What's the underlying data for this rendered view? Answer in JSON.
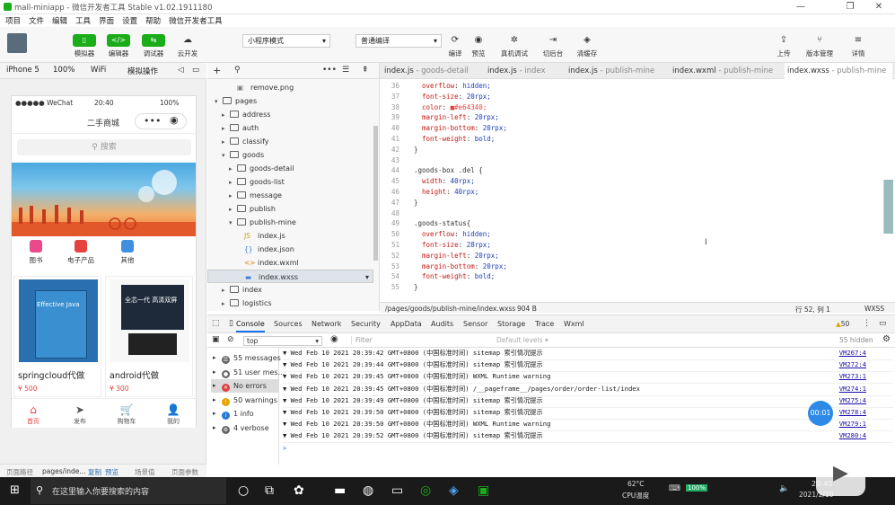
{
  "window": {
    "title": "mall-miniapp - 微信开发者工具 Stable v1.02.1911180",
    "controls": [
      "—",
      "❐",
      "✕"
    ]
  },
  "menu": [
    "项目",
    "文件",
    "编辑",
    "工具",
    "界面",
    "设置",
    "帮助",
    "微信开发者工具"
  ],
  "toolbar": {
    "left": [
      {
        "label": "模拟器",
        "icon": "phone-icon"
      },
      {
        "label": "编辑器",
        "icon": "code-icon"
      },
      {
        "label": "调试器",
        "icon": "debug-icon"
      },
      {
        "label": "云开发",
        "icon": "cloud-icon"
      }
    ],
    "mode_select": "小程序模式",
    "compile_select": "普通编译",
    "middle": [
      {
        "label": "编译",
        "icon": "refresh-icon"
      },
      {
        "label": "预览",
        "icon": "eye-icon"
      },
      {
        "label": "真机调试",
        "icon": "bug-icon"
      },
      {
        "label": "切后台",
        "icon": "switch-icon"
      },
      {
        "label": "清缓存",
        "icon": "layers-icon"
      }
    ],
    "right": [
      {
        "label": "上传",
        "icon": "upload-icon"
      },
      {
        "label": "版本管理",
        "icon": "branch-icon"
      },
      {
        "label": "详情",
        "icon": "menu-icon"
      }
    ]
  },
  "device_bar": {
    "device": "iPhone 5",
    "zoom": "100%",
    "network": "WiFi",
    "ops": "模拟操作"
  },
  "phone": {
    "carrier": "●●●●● WeChat",
    "time": "20:40",
    "battery": "100%",
    "nav_title": "二手商城",
    "search_placeholder": "搜索",
    "categories": [
      "图书",
      "电子产品",
      "其他"
    ],
    "products": [
      {
        "name": "springcloud代做",
        "price": "¥ 500",
        "book_title": "Effective Java"
      },
      {
        "name": "android代做",
        "price": "¥ 300",
        "banner": "全芯一代 高清双屏"
      }
    ],
    "tabs": [
      "首页",
      "发布",
      "购物车",
      "我的"
    ],
    "tab_icons": [
      "⌂",
      "➤",
      "🛒",
      "👤"
    ]
  },
  "page_path": {
    "label": "页面路径",
    "value": "pages/inde...",
    "copy": "复制",
    "preview": "预览",
    "scene": "场景值",
    "params": "页面参数"
  },
  "explorer": {
    "items": [
      {
        "depth": 3,
        "type": "file",
        "icon": "image-icon",
        "name": "remove.png"
      },
      {
        "depth": 1,
        "type": "folder",
        "open": true,
        "name": "pages"
      },
      {
        "depth": 2,
        "type": "folder",
        "open": false,
        "name": "address"
      },
      {
        "depth": 2,
        "type": "folder",
        "open": false,
        "name": "auth"
      },
      {
        "depth": 2,
        "type": "folder",
        "open": false,
        "name": "classify"
      },
      {
        "depth": 2,
        "type": "folder",
        "open": true,
        "name": "goods"
      },
      {
        "depth": 3,
        "type": "folder",
        "open": false,
        "name": "goods-detail"
      },
      {
        "depth": 3,
        "type": "folder",
        "open": false,
        "name": "goods-list"
      },
      {
        "depth": 3,
        "type": "folder",
        "open": false,
        "name": "message"
      },
      {
        "depth": 3,
        "type": "folder",
        "open": false,
        "name": "publish"
      },
      {
        "depth": 3,
        "type": "folder",
        "open": true,
        "name": "publish-mine"
      },
      {
        "depth": 4,
        "type": "file",
        "icon": "js-icon",
        "name": "index.js"
      },
      {
        "depth": 4,
        "type": "file",
        "icon": "json-icon",
        "name": "index.json"
      },
      {
        "depth": 4,
        "type": "file",
        "icon": "wxml-icon",
        "name": "index.wxml"
      },
      {
        "depth": 4,
        "type": "file",
        "icon": "wxss-icon",
        "name": "index.wxss",
        "selected": true
      },
      {
        "depth": 2,
        "type": "folder",
        "open": false,
        "name": "index"
      },
      {
        "depth": 2,
        "type": "folder",
        "open": false,
        "name": "logistics"
      }
    ]
  },
  "editor": {
    "tabs": [
      {
        "name": "index.js",
        "sub": " - goods-detail"
      },
      {
        "name": "index.js",
        "sub": " - index"
      },
      {
        "name": "index.js",
        "sub": " - publish-mine"
      },
      {
        "name": "index.wxml",
        "sub": " - publish-mine"
      },
      {
        "name": "index.wxss",
        "sub": " - publish-mine",
        "active": true
      }
    ],
    "lines": [
      {
        "n": "36",
        "t": "  overflow: hidden;"
      },
      {
        "n": "37",
        "t": "  font-size: 20rpx;"
      },
      {
        "n": "38",
        "t": "  color: ■#e64340;"
      },
      {
        "n": "39",
        "t": "  margin-left: 20rpx;"
      },
      {
        "n": "40",
        "t": "  margin-bottom: 20rpx;"
      },
      {
        "n": "41",
        "t": "  font-weight: bold;"
      },
      {
        "n": "42",
        "t": "}"
      },
      {
        "n": "43",
        "t": ""
      },
      {
        "n": "44",
        "t": ".goods-box .del {"
      },
      {
        "n": "45",
        "t": "  width: 40rpx;"
      },
      {
        "n": "46",
        "t": "  height: 40rpx;"
      },
      {
        "n": "47",
        "t": "}"
      },
      {
        "n": "48",
        "t": ""
      },
      {
        "n": "49",
        "t": ".goods-status{"
      },
      {
        "n": "50",
        "t": "  overflow: hidden;"
      },
      {
        "n": "51",
        "t": "  font-size: 28rpx;"
      },
      {
        "n": "52",
        "t": "  margin-left: 20rpx;"
      },
      {
        "n": "53",
        "t": "  margin-bottom: 20rpx;"
      },
      {
        "n": "54",
        "t": "  font-weight: bold;"
      },
      {
        "n": "55",
        "t": "}"
      }
    ],
    "status_path": "/pages/goods/publish-mine/index.wxss",
    "status_size": "904 B",
    "status_pos": "行 52, 列 1",
    "status_lang": "WXSS"
  },
  "console": {
    "tabs": [
      "Console",
      "Sources",
      "Network",
      "Security",
      "AppData",
      "Audits",
      "Sensor",
      "Storage",
      "Trace",
      "Wxml"
    ],
    "warn_count": "50",
    "context": "top",
    "filter_placeholder": "Filter",
    "levels": "Default levels ▾",
    "hidden": "55 hidden",
    "sidebar": [
      {
        "label": "55 messages",
        "icon": "list-icon",
        "color": "#666"
      },
      {
        "label": "51 user mes...",
        "icon": "user-icon",
        "color": "#666"
      },
      {
        "label": "No errors",
        "icon": "error-icon",
        "color": "#e04040",
        "active": true
      },
      {
        "label": "50 warnings",
        "icon": "warning-icon",
        "color": "#e5a400"
      },
      {
        "label": "1 info",
        "icon": "info-icon",
        "color": "#2979d6"
      },
      {
        "label": "4 verbose",
        "icon": "verbose-icon",
        "color": "#666"
      }
    ],
    "logs": [
      {
        "text": "▼ Wed Feb 10 2021 20:39:42 GMT+0800 (中国标准时间) sitemap 索引情况提示",
        "src": "VM267:4"
      },
      {
        "text": "▼ Wed Feb 10 2021 20:39:44 GMT+0800 (中国标准时间) sitemap 索引情况提示",
        "src": "VM272:4"
      },
      {
        "text": "▼ Wed Feb 10 2021 20:39:45 GMT+0800 (中国标准时间) WXML Runtime warning",
        "src": "VM273:1"
      },
      {
        "text": "▼ Wed Feb 10 2021 20:39:45 GMT+0800 (中国标准时间) /__pageframe__/pages/order/order-list/index",
        "src": "VM274:1"
      },
      {
        "text": "▼ Wed Feb 10 2021 20:39:49 GMT+0800 (中国标准时间) sitemap 索引情况提示",
        "src": "VM275:4"
      },
      {
        "text": "▼ Wed Feb 10 2021 20:39:50 GMT+0800 (中国标准时间) sitemap 索引情况提示",
        "src": "VM278:4"
      },
      {
        "text": "▼ Wed Feb 10 2021 20:39:50 GMT+0800 (中国标准时间) WXML Runtime warning",
        "src": "VM279:1"
      },
      {
        "text": "▼ Wed Feb 10 2021 20:39:52 GMT+0800 (中国标准时间) sitemap 索引情况提示",
        "src": "VM280:4"
      }
    ],
    "prompt": ">",
    "timer_bubble": "00:01"
  },
  "taskbar": {
    "search_placeholder": "在这里输入你要搜索的内容",
    "temp": "62°C",
    "temp_label": "CPU温度",
    "time": "20:40",
    "date": "2021/2/10",
    "battery": "100%"
  },
  "colors": {
    "accent": "#1aad19",
    "price": "#e64340",
    "tab_active": "#e64340"
  }
}
